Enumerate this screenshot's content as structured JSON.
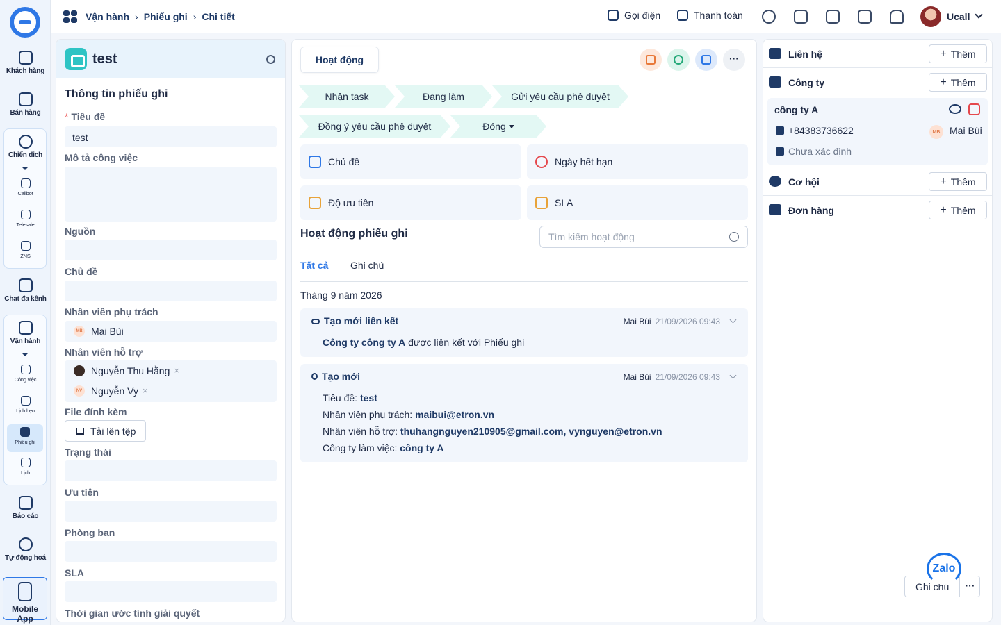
{
  "rail": {
    "items": [
      "Khách hàng",
      "Bán hàng",
      "Chiến dịch",
      "Callbot",
      "Telesale",
      "ZNS",
      "Chat đa kênh",
      "Vận hành",
      "Công việc",
      "Lịch hẹn",
      "Phiếu ghi",
      "Lịch",
      "Báo cáo",
      "Tự động hoá"
    ],
    "mobile": "Mobile App"
  },
  "breadcrumb": {
    "b1": "Vận hành",
    "b2": "Phiếu ghi",
    "b3": "Chi tiết"
  },
  "topbar": {
    "call": "Gọi điện",
    "pay": "Thanh toán",
    "user": "Ucall"
  },
  "left": {
    "title": "test",
    "section": "Thông tin phiếu ghi",
    "labels": {
      "title": "Tiêu đề",
      "desc": "Mô tả công việc",
      "source": "Nguồn",
      "topic": "Chủ đề",
      "owner": "Nhân viên phụ trách",
      "support": "Nhân viên hỗ trợ",
      "file": "File đính kèm",
      "status": "Trạng thái",
      "priority": "Ưu tiên",
      "dept": "Phòng ban",
      "sla": "SLA",
      "eta": "Thời gian ước tính giải quyết"
    },
    "values": {
      "title": "test",
      "owner": "Mai Bùi",
      "owner_init": "MB",
      "support1": "Nguyễn Thu Hằng",
      "support2": "Nguyễn Vy",
      "support2_init": "NV",
      "x": "×",
      "upload": "Tải lên tệp"
    }
  },
  "center": {
    "tab": "Hoạt động",
    "steps": [
      "Nhận task",
      "Đang làm",
      "Gửi yêu cầu phê duyệt",
      "Đồng ý yêu cầu phê duyệt",
      "Đóng"
    ],
    "cards": [
      "Chủ đề",
      "Ngày hết hạn",
      "Độ ưu tiên",
      "SLA"
    ],
    "activity_title": "Hoạt động phiếu ghi",
    "search_placeholder": "Tìm kiếm hoạt động",
    "filter_all": "Tất cả",
    "filter_notes": "Ghi chú",
    "month": "Tháng 9 năm 2026",
    "a1": {
      "title": "Tạo mới liên kết",
      "user": "Mai Bùi",
      "time": "21/09/2026 09:43",
      "link": "Công ty công ty A",
      "text": " được liên kết với Phiếu ghi"
    },
    "a2": {
      "title": "Tạo mới",
      "user": "Mai Bùi",
      "time": "21/09/2026 09:43",
      "l1k": "Tiêu đề: ",
      "l1v": "test",
      "l2k": "Nhân viên phụ trách: ",
      "l2v": "maibui@etron.vn",
      "l3k": "Nhân viên hỗ trợ: ",
      "l3v": "thuhangnguyen210905@gmail.com, vynguyen@etron.vn",
      "l4k": "Công ty làm việc: ",
      "l4v": "công ty A"
    }
  },
  "right": {
    "contact": "Liên hệ",
    "company": "Công ty",
    "opportunity": "Cơ hội",
    "order": "Đơn hàng",
    "add": "Thêm",
    "co": {
      "name": "công ty A",
      "phone": "+84383736622",
      "email": "Chưa xác định",
      "owner_init": "MB",
      "owner": "Mai Bùi"
    }
  },
  "note": {
    "label": "Ghi chú",
    "more": "···",
    "zalo": "Zalo"
  }
}
